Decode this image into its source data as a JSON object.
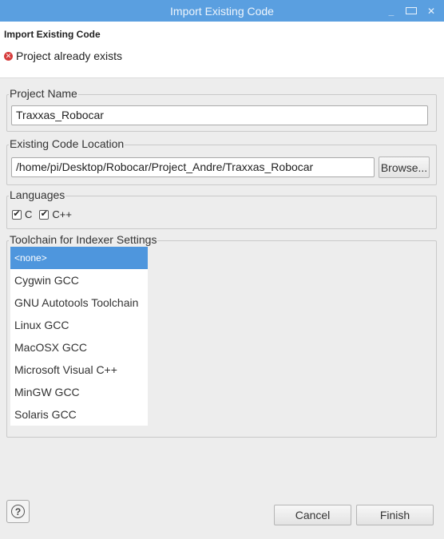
{
  "window": {
    "title": "Import Existing Code"
  },
  "header": {
    "title": "Import Existing Code",
    "message": "Project already exists"
  },
  "project_name": {
    "legend": "Project Name",
    "value": "Traxxas_Robocar"
  },
  "code_location": {
    "legend": "Existing Code Location",
    "value": "/home/pi/Desktop/Robocar/Project_Andre/Traxxas_Robocar",
    "browse_label": "Browse..."
  },
  "languages": {
    "legend": "Languages",
    "items": [
      {
        "label": "C",
        "checked": true
      },
      {
        "label": "C++",
        "checked": true
      }
    ]
  },
  "toolchain": {
    "legend": "Toolchain for Indexer Settings",
    "selected": "<none>",
    "items": [
      "<none>",
      "Cygwin GCC",
      "GNU Autotools Toolchain",
      "Linux GCC",
      "MacOSX GCC",
      "Microsoft Visual C++",
      "MinGW GCC",
      "Solaris GCC"
    ]
  },
  "footer": {
    "help_symbol": "?",
    "cancel_label": "Cancel",
    "finish_label": "Finish"
  },
  "colors": {
    "titlebar": "#5a9fe0",
    "selection": "#4e96dd",
    "error": "#d63c3c"
  }
}
